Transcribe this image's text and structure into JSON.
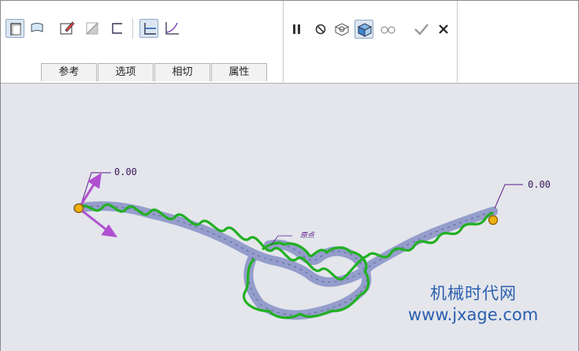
{
  "toolbar": {
    "tabs": [
      "参考",
      "选项",
      "相切",
      "属性"
    ]
  },
  "canvas": {
    "dim_left": "0.00",
    "dim_right": "0.00",
    "point_label": "原点"
  },
  "watermark": {
    "line1": "机械时代网",
    "line2": "www.jxage.com"
  },
  "colors": {
    "curve": "#22b022",
    "sweep": "#8c96c8",
    "arrow": "#b050d0",
    "endpoint": "#f0b010"
  },
  "icons": [
    "solid-icon",
    "surface-icon",
    "sketch-edit-icon",
    "remove-material-icon",
    "thin-icon",
    "constant-section-icon",
    "variable-section-icon",
    "pause-icon",
    "no-preview-icon",
    "preview-icon",
    "verify-icon",
    "glasses-icon",
    "ok-icon",
    "cancel-icon"
  ]
}
